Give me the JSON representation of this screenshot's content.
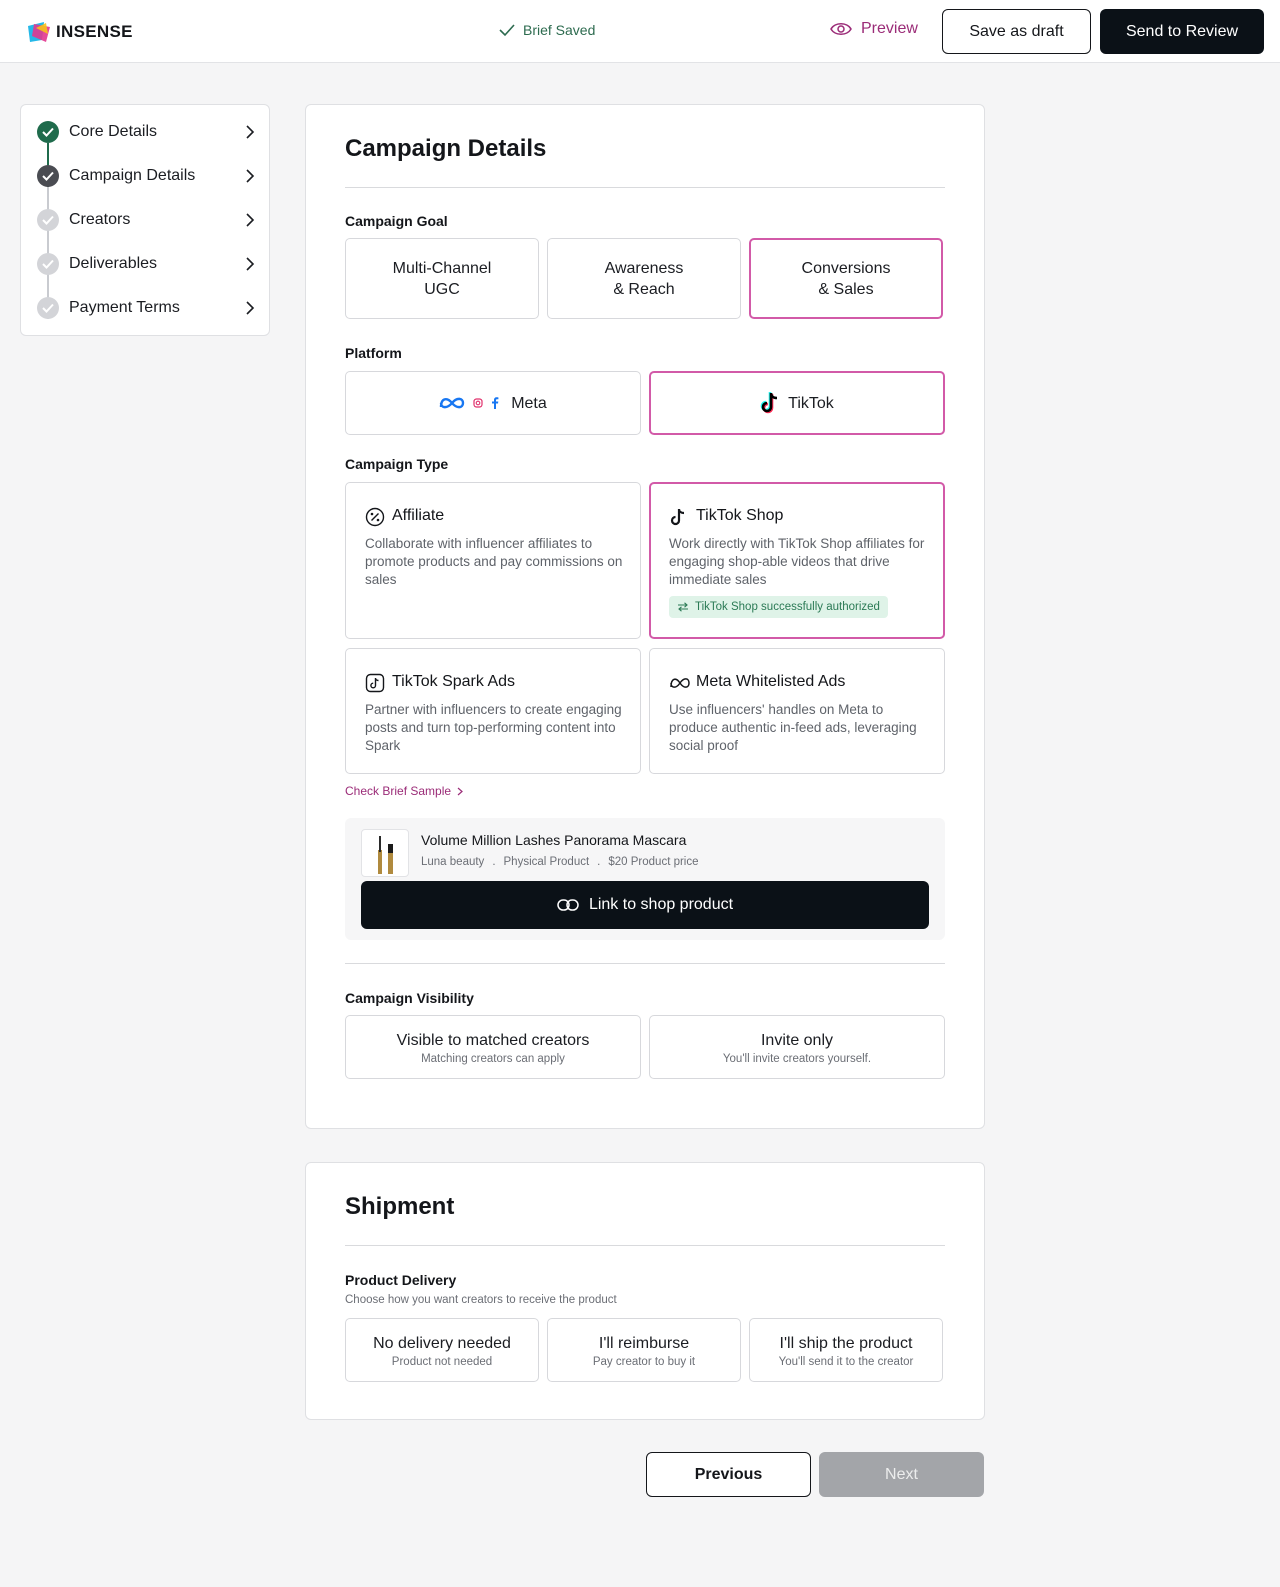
{
  "header": {
    "logo_text": "INSENSE",
    "status": "Brief Saved",
    "preview_label": "Preview",
    "save_draft_label": "Save as draft",
    "send_review_label": "Send to Review"
  },
  "stepper": {
    "items": [
      {
        "label": "Core Details",
        "state": "complete"
      },
      {
        "label": "Campaign Details",
        "state": "current"
      },
      {
        "label": "Creators",
        "state": "pending"
      },
      {
        "label": "Deliverables",
        "state": "pending"
      },
      {
        "label": "Payment Terms",
        "state": "pending"
      }
    ]
  },
  "campaign": {
    "title": "Campaign Details",
    "goal": {
      "label": "Campaign Goal",
      "options": [
        {
          "line1": "Multi-Channel",
          "line2": "UGC",
          "selected": false
        },
        {
          "line1": "Awareness",
          "line2": "& Reach",
          "selected": false
        },
        {
          "line1": "Conversions",
          "line2": "& Sales",
          "selected": true
        }
      ]
    },
    "platform": {
      "label": "Platform",
      "options": [
        {
          "label": "Meta",
          "icon": "meta-icon",
          "selected": false
        },
        {
          "label": "TikTok",
          "icon": "tiktok-icon",
          "selected": true
        }
      ]
    },
    "type": {
      "label": "Campaign Type",
      "options": [
        {
          "title": "Affiliate",
          "icon": "percent-badge-icon",
          "desc": "Collaborate with influencer affiliates to promote products and pay commissions on sales",
          "selected": false
        },
        {
          "title": "TikTok Shop",
          "icon": "tiktok-icon",
          "desc": "Work directly with TikTok Shop affiliates for engaging shop-able videos that drive immediate sales",
          "selected": true,
          "badge": "TikTok Shop successfully authorized"
        },
        {
          "title": "TikTok Spark Ads",
          "icon": "tiktok-square-icon",
          "desc": "Partner with influencers to create engaging posts and turn top-performing content into Spark",
          "selected": false
        },
        {
          "title": "Meta Whitelisted Ads",
          "icon": "meta-icon",
          "desc": "Use influencers' handles on Meta to produce authentic in-feed ads, leveraging social proof",
          "selected": false
        }
      ]
    },
    "brief_sample_link": "Check Brief Sample",
    "product": {
      "name": "Volume Million Lashes Panorama Mascara",
      "brand": "Luna beauty",
      "kind": "Physical Product",
      "price": "$20 Product price",
      "sep": ".",
      "link_button": "Link to shop product"
    },
    "visibility": {
      "label": "Campaign Visibility",
      "options": [
        {
          "title": "Visible to matched creators",
          "sub": "Matching creators can apply",
          "selected": false
        },
        {
          "title": "Invite only",
          "sub": "You'll invite creators yourself.",
          "selected": false
        }
      ]
    }
  },
  "shipment": {
    "title": "Shipment",
    "delivery": {
      "label": "Product Delivery",
      "hint": "Choose how you want creators to receive the product",
      "options": [
        {
          "title": "No delivery needed",
          "sub": "Product not needed"
        },
        {
          "title": "I'll reimburse",
          "sub": "Pay creator to buy it"
        },
        {
          "title": "I'll ship the product",
          "sub": "You'll send it to the creator"
        }
      ]
    }
  },
  "footer": {
    "previous_label": "Previous",
    "next_label": "Next"
  },
  "colors": {
    "accent": "#d25aa8",
    "accent_text": "#9b2c78",
    "success": "#1f6b4c",
    "dark": "#0b1117",
    "disabled": "#a3a5a9"
  }
}
